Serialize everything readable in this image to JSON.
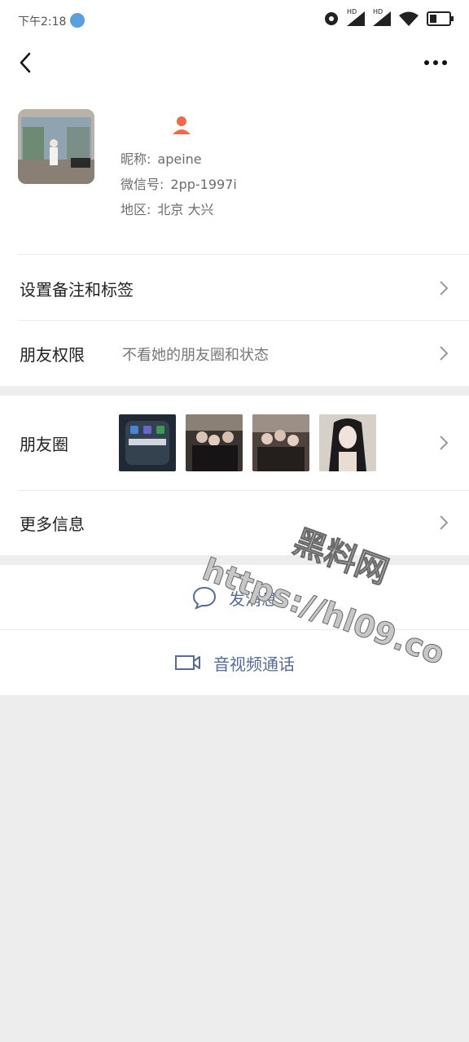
{
  "status_bar": {
    "time": "下午2:18"
  },
  "profile": {
    "nickname_label": "昵称:",
    "nickname": "apeine",
    "wechat_id_label": "微信号:",
    "wechat_id": "2pp-1997i",
    "region_label": "地区:",
    "region": "北京  大兴"
  },
  "cells": {
    "remark_label": "设置备注和标签",
    "permission_label": "朋友权限",
    "permission_detail": "不看她的朋友圈和状态",
    "moments_label": "朋友圈",
    "more_info_label": "更多信息"
  },
  "actions": {
    "send_message": "发消息",
    "video_call": "音视频通话"
  },
  "watermark": {
    "line1": "黑料网",
    "line2": "https://hl09.co"
  },
  "colors": {
    "link_blue": "#576b95",
    "page_bg": "#ededed",
    "badge_orange": "#f06a4a"
  }
}
